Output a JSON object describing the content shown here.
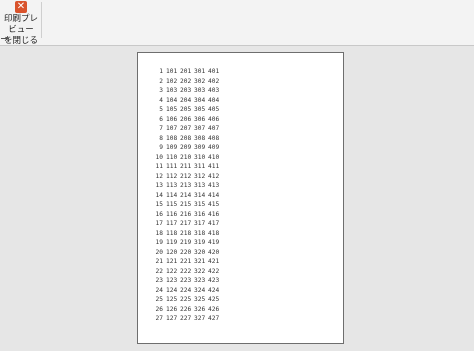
{
  "toolbar": {
    "close_icon_glyph": "✕",
    "close_label": "印刷プレビュー\nを閉じる"
  },
  "preview": {
    "rows": [
      [
        "1",
        "101",
        "201",
        "301",
        "401"
      ],
      [
        "2",
        "102",
        "202",
        "302",
        "402"
      ],
      [
        "3",
        "103",
        "203",
        "303",
        "403"
      ],
      [
        "4",
        "104",
        "204",
        "304",
        "404"
      ],
      [
        "5",
        "105",
        "205",
        "305",
        "405"
      ],
      [
        "6",
        "106",
        "206",
        "306",
        "406"
      ],
      [
        "7",
        "107",
        "207",
        "307",
        "407"
      ],
      [
        "8",
        "108",
        "208",
        "308",
        "408"
      ],
      [
        "9",
        "109",
        "209",
        "309",
        "409"
      ],
      [
        "10",
        "110",
        "210",
        "310",
        "410"
      ],
      [
        "11",
        "111",
        "211",
        "311",
        "411"
      ],
      [
        "12",
        "112",
        "212",
        "312",
        "412"
      ],
      [
        "13",
        "113",
        "213",
        "313",
        "413"
      ],
      [
        "14",
        "114",
        "214",
        "314",
        "414"
      ],
      [
        "15",
        "115",
        "215",
        "315",
        "415"
      ],
      [
        "16",
        "116",
        "216",
        "316",
        "416"
      ],
      [
        "17",
        "117",
        "217",
        "317",
        "417"
      ],
      [
        "18",
        "118",
        "218",
        "318",
        "418"
      ],
      [
        "19",
        "119",
        "219",
        "319",
        "419"
      ],
      [
        "20",
        "120",
        "220",
        "320",
        "420"
      ],
      [
        "21",
        "121",
        "221",
        "321",
        "421"
      ],
      [
        "22",
        "122",
        "222",
        "322",
        "422"
      ],
      [
        "23",
        "123",
        "223",
        "323",
        "423"
      ],
      [
        "24",
        "124",
        "224",
        "324",
        "424"
      ],
      [
        "25",
        "125",
        "225",
        "325",
        "425"
      ],
      [
        "26",
        "126",
        "226",
        "326",
        "426"
      ],
      [
        "27",
        "127",
        "227",
        "327",
        "427"
      ]
    ]
  }
}
